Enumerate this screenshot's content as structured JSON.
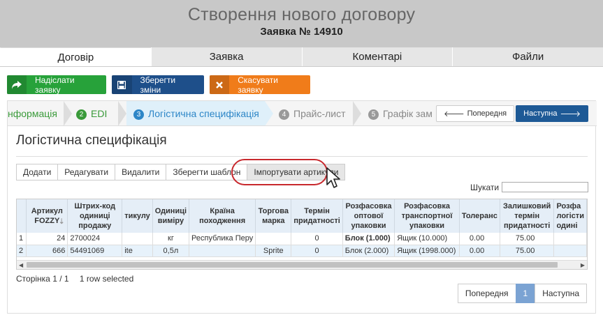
{
  "header": {
    "title": "Створення нового договору",
    "subtitle": "Заявка № 14910"
  },
  "main_tabs": [
    {
      "label": "Договір",
      "active": true
    },
    {
      "label": "Заявка",
      "active": false
    },
    {
      "label": "Коментарі",
      "active": false
    },
    {
      "label": "Файли",
      "active": false
    }
  ],
  "actions": {
    "send": {
      "label": "Надіслати заявку",
      "icon": "share-arrow-icon"
    },
    "save": {
      "label": "Зберегти зміни",
      "icon": "floppy-disk-icon"
    },
    "cancel": {
      "label": "Скасувати заявку",
      "icon": "close-icon"
    }
  },
  "wizard": {
    "steps": [
      {
        "num": "",
        "label": "нформація",
        "state": "done"
      },
      {
        "num": "2",
        "label": "EDI",
        "state": "done"
      },
      {
        "num": "3",
        "label": "Логістична специфікація",
        "state": "active"
      },
      {
        "num": "4",
        "label": "Прайс-лист",
        "state": "pending"
      },
      {
        "num": "5",
        "label": "Графік замовлень/по",
        "state": "pending"
      }
    ],
    "prev": "Попередня",
    "next": "Наступна"
  },
  "section_title": "Логістична специфікація",
  "toolbar": {
    "add": "Додати",
    "edit": "Редагувати",
    "delete": "Видалити",
    "save_template": "Зберегти шаблон",
    "import": "Імпортувати артикули"
  },
  "search": {
    "label": "Шукати",
    "value": ""
  },
  "grid": {
    "columns": {
      "num": "",
      "article": "Артикул FOZZY",
      "barcode": "Штрих-код одиниці продажу",
      "supplier_article": "тикулу",
      "unit": "Одиниці виміру",
      "country": "Країна походження",
      "brand": "Торгова марка",
      "shelf_life": "Термін придатності",
      "wholesale_pack": "Розфасовка оптової упаковки",
      "transport_pack": "Розфасовка транспортної упаковки",
      "tolerance": "Толеранс",
      "remaining_life": "Залишковий термін придатності",
      "logistic": "Розфа логісти одині"
    },
    "rows": [
      {
        "num": "1",
        "article": "24",
        "barcode": "2700024",
        "supplier_article": "",
        "unit": "кг",
        "country": "Республика Перу",
        "brand": "",
        "shelf_life": "0",
        "wholesale_pack": "Блок (1.000)",
        "transport_pack": "Ящик (10.000)",
        "tolerance": "0.00",
        "remaining_life": "75.00",
        "logistic": ""
      },
      {
        "num": "2",
        "article": "666",
        "barcode": "54491069",
        "supplier_article": "ite",
        "unit": "0,5л",
        "country": "",
        "brand": "Sprite",
        "shelf_life": "0",
        "wholesale_pack": "Блок (2.000)",
        "transport_pack": "Ящик (1998.000)",
        "tolerance": "0.00",
        "remaining_life": "75.00",
        "logistic": ""
      }
    ]
  },
  "footer": {
    "page_info": "Сторінка 1 / 1",
    "selection": "1 row selected"
  },
  "pager": {
    "prev": "Попередня",
    "current": "1",
    "next": "Наступна"
  },
  "colors": {
    "green": "#27a23a",
    "blue": "#1e4f8a",
    "orange": "#f07c1a",
    "highlight": "#c8282d"
  }
}
